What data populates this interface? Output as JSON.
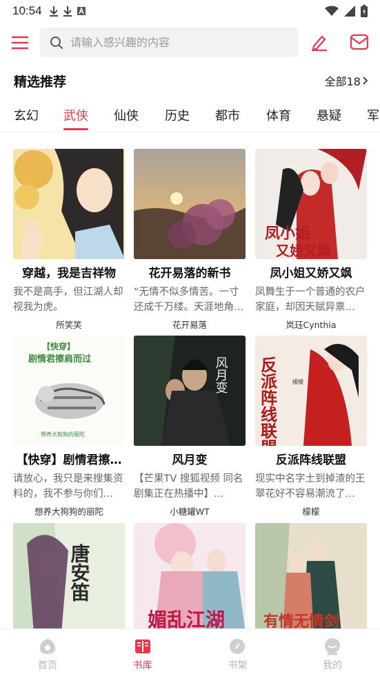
{
  "status_bar": {
    "time": "10:54"
  },
  "search": {
    "placeholder": "请输入感兴趣的内容"
  },
  "section": {
    "title": "精选推荐",
    "all_label": "全部18"
  },
  "tabs": [
    {
      "label": "玄幻"
    },
    {
      "label": "武侠"
    },
    {
      "label": "仙侠"
    },
    {
      "label": "历史"
    },
    {
      "label": "都市"
    },
    {
      "label": "体育"
    },
    {
      "label": "悬疑"
    },
    {
      "label": "军"
    }
  ],
  "active_tab": "武侠",
  "books": [
    {
      "title": "穿越，我是吉祥物",
      "desc": "我不是高手，但江湖人却视我为虎。",
      "author": "所笑笑"
    },
    {
      "title": "花开易落的新书",
      "desc": "“无情不似多情苦。一寸还成千万缕。天涯地角…",
      "author": "花开易落"
    },
    {
      "title": "凤小姐又娇又飒",
      "desc": "凤舞生于一个普通的农户家庭，却因天赋异禀…",
      "author": "岚珏Cynthia"
    },
    {
      "title": "【快穿】剧情君擦…",
      "desc": "请放心，我只是来搜集资料的，我不参与你们…",
      "author": "想养大狗狗的丽陀",
      "cover_text": [
        "【快穿】",
        "剧情君擦肩而过",
        "想养大狗狗的丽陀"
      ]
    },
    {
      "title": "风月变",
      "desc": "【芒果TV 搜狐视频 同名剧集正在热播中】…",
      "author": "小糖罐WT",
      "cover_text": [
        "风月变"
      ]
    },
    {
      "title": "反派阵线联盟",
      "desc": "现实中名字土到掉渣的王翠花好不容易潮流了…",
      "author": "檬檬",
      "cover_text": [
        "反派阵线联盟",
        "檬檬"
      ]
    },
    {
      "title": "",
      "desc": "",
      "author": "",
      "cover_text": [
        "唐安笛"
      ]
    },
    {
      "title": "",
      "desc": "",
      "author": "",
      "cover_text": [
        "媚乱江湖"
      ]
    },
    {
      "title": "",
      "desc": "",
      "author": "",
      "cover_text": [
        "有情无情剑"
      ]
    }
  ],
  "bottom_nav": [
    {
      "label": "首页",
      "icon": "home-icon"
    },
    {
      "label": "书库",
      "icon": "library-icon"
    },
    {
      "label": "书架",
      "icon": "compass-icon"
    },
    {
      "label": "我的",
      "icon": "profile-icon"
    }
  ],
  "colors": {
    "accent": "#e8374a",
    "muted": "#b5b5b5"
  }
}
